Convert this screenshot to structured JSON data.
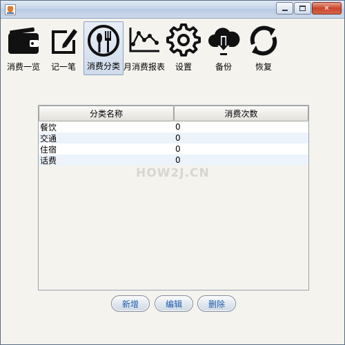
{
  "window": {
    "title": "",
    "controls": {
      "minimize": "–",
      "maximize": "□",
      "close": "✕"
    }
  },
  "toolbar": {
    "items": [
      {
        "label": "消费一览",
        "icon": "wallet-icon"
      },
      {
        "label": "记一笔",
        "icon": "pencil-edit-icon"
      },
      {
        "label": "消费分类",
        "icon": "dining-icon"
      },
      {
        "label": "月消费报表",
        "icon": "line-chart-icon"
      },
      {
        "label": "设置",
        "icon": "gear-icon"
      },
      {
        "label": "备份",
        "icon": "cloud-download-icon"
      },
      {
        "label": "恢复",
        "icon": "refresh-icon"
      }
    ],
    "active": "消费分类"
  },
  "table": {
    "columns": [
      "分类名称",
      "消费次数"
    ],
    "rows": [
      [
        "餐饮",
        "0"
      ],
      [
        "交通",
        "0"
      ],
      [
        "住宿",
        "0"
      ],
      [
        "话费",
        "0"
      ]
    ]
  },
  "watermark": {
    "text": "HOW2J.CN"
  },
  "actions": {
    "add": "新增",
    "edit": "编辑",
    "delete": "删除"
  },
  "colors": {
    "button_text": "#1d5cab",
    "row_alt": "#edf3fb",
    "active_tool_bg": "#cfdbeb"
  }
}
